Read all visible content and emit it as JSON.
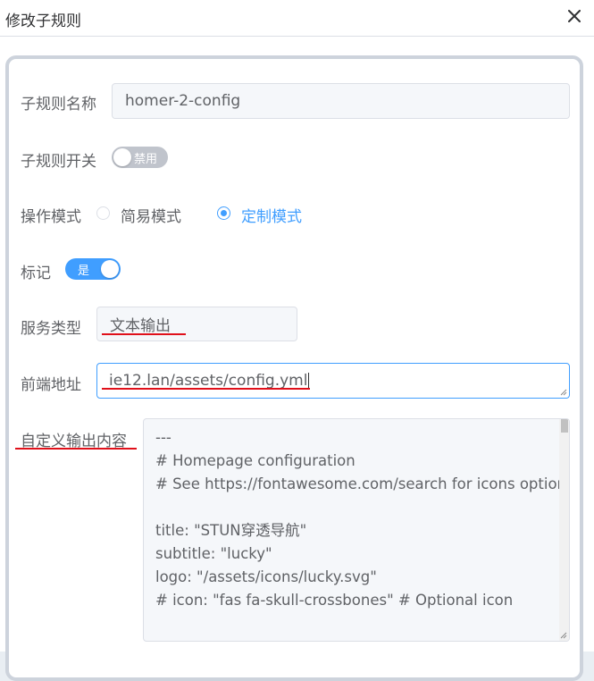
{
  "dialog": {
    "title": "修改子规则",
    "close_icon": "close-icon"
  },
  "form": {
    "name": {
      "label": "子规则名称",
      "value": "homer-2-config"
    },
    "enable_switch": {
      "label": "子规则开关",
      "state_text": "禁用",
      "on": false
    },
    "mode": {
      "label": "操作模式",
      "options": [
        {
          "label": "简易模式",
          "selected": false
        },
        {
          "label": "定制模式",
          "selected": true
        }
      ]
    },
    "mark": {
      "label": "标记",
      "state_text": "是",
      "on": true
    },
    "service_type": {
      "label": "服务类型",
      "value": "文本输出"
    },
    "frontend_address": {
      "label": "前端地址",
      "value": "ie12.lan/assets/config.yml"
    },
    "custom_output": {
      "label": "自定义输出内容",
      "lines": [
        "---",
        "# Homepage configuration",
        "# See https://fontawesome.com/search for icons options",
        "",
        "title: \"STUN穿透导航\"",
        "subtitle: \"lucky\"",
        "logo: \"/assets/icons/lucky.svg\"",
        "# icon: \"fas fa-skull-crossbones\" # Optional icon"
      ]
    }
  },
  "colors": {
    "accent": "#409eff",
    "annotation_red": "#e0101a",
    "switch_off": "#c0c4cc"
  }
}
